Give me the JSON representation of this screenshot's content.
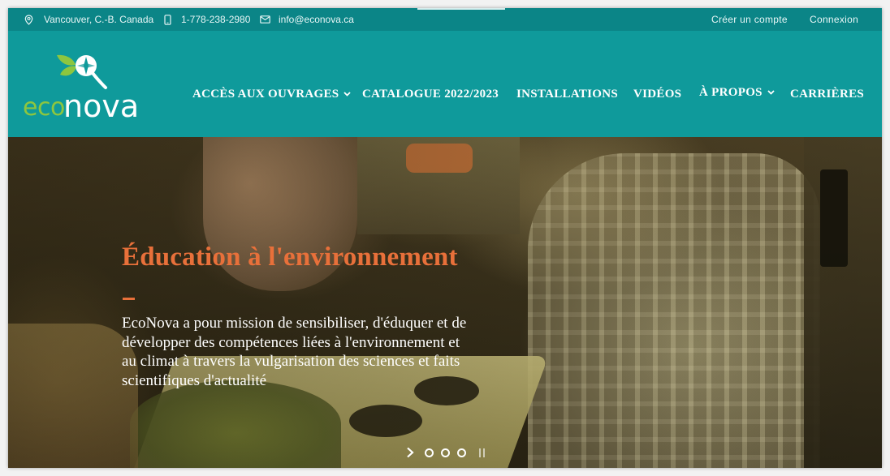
{
  "topbar": {
    "location": "Vancouver, C.-B. Canada",
    "phone": "1-778-238-2980",
    "email": "info@econova.ca",
    "create_account": "Créer un compte",
    "login": "Connexion"
  },
  "logo": {
    "eco": "eco",
    "nova": "nova"
  },
  "nav": {
    "items": [
      {
        "label": "ACCÈS AUX OUVRAGES",
        "has_dropdown": true
      },
      {
        "label": "CATALOGUE 2022/2023",
        "has_dropdown": false
      },
      {
        "label": "INSTALLATIONS",
        "has_dropdown": false
      },
      {
        "label": "VIDÉOS",
        "has_dropdown": false
      },
      {
        "label": "À PROPOS",
        "has_dropdown": true
      },
      {
        "label": "CARRIÈRES",
        "has_dropdown": false
      }
    ]
  },
  "hero": {
    "title": "Éducation à l'environnement",
    "text": "EcoNova a pour mission de sensibiliser, d'éduquer et de développer des compétences liées à l'environnement et au climat à travers la vulgarisation des sciences et faits scientifiques d'actualité"
  },
  "slider": {
    "dots": 3
  },
  "colors": {
    "header_bg": "#0f9a9b",
    "topbar_bg": "#0b8587",
    "accent_orange": "#e8703a",
    "logo_green": "#8dc63f"
  },
  "icons": {
    "location": "map-pin-icon",
    "phone": "mobile-phone-icon",
    "email": "envelope-icon",
    "next": "chevron-right-icon",
    "pause": "pause-icon"
  }
}
